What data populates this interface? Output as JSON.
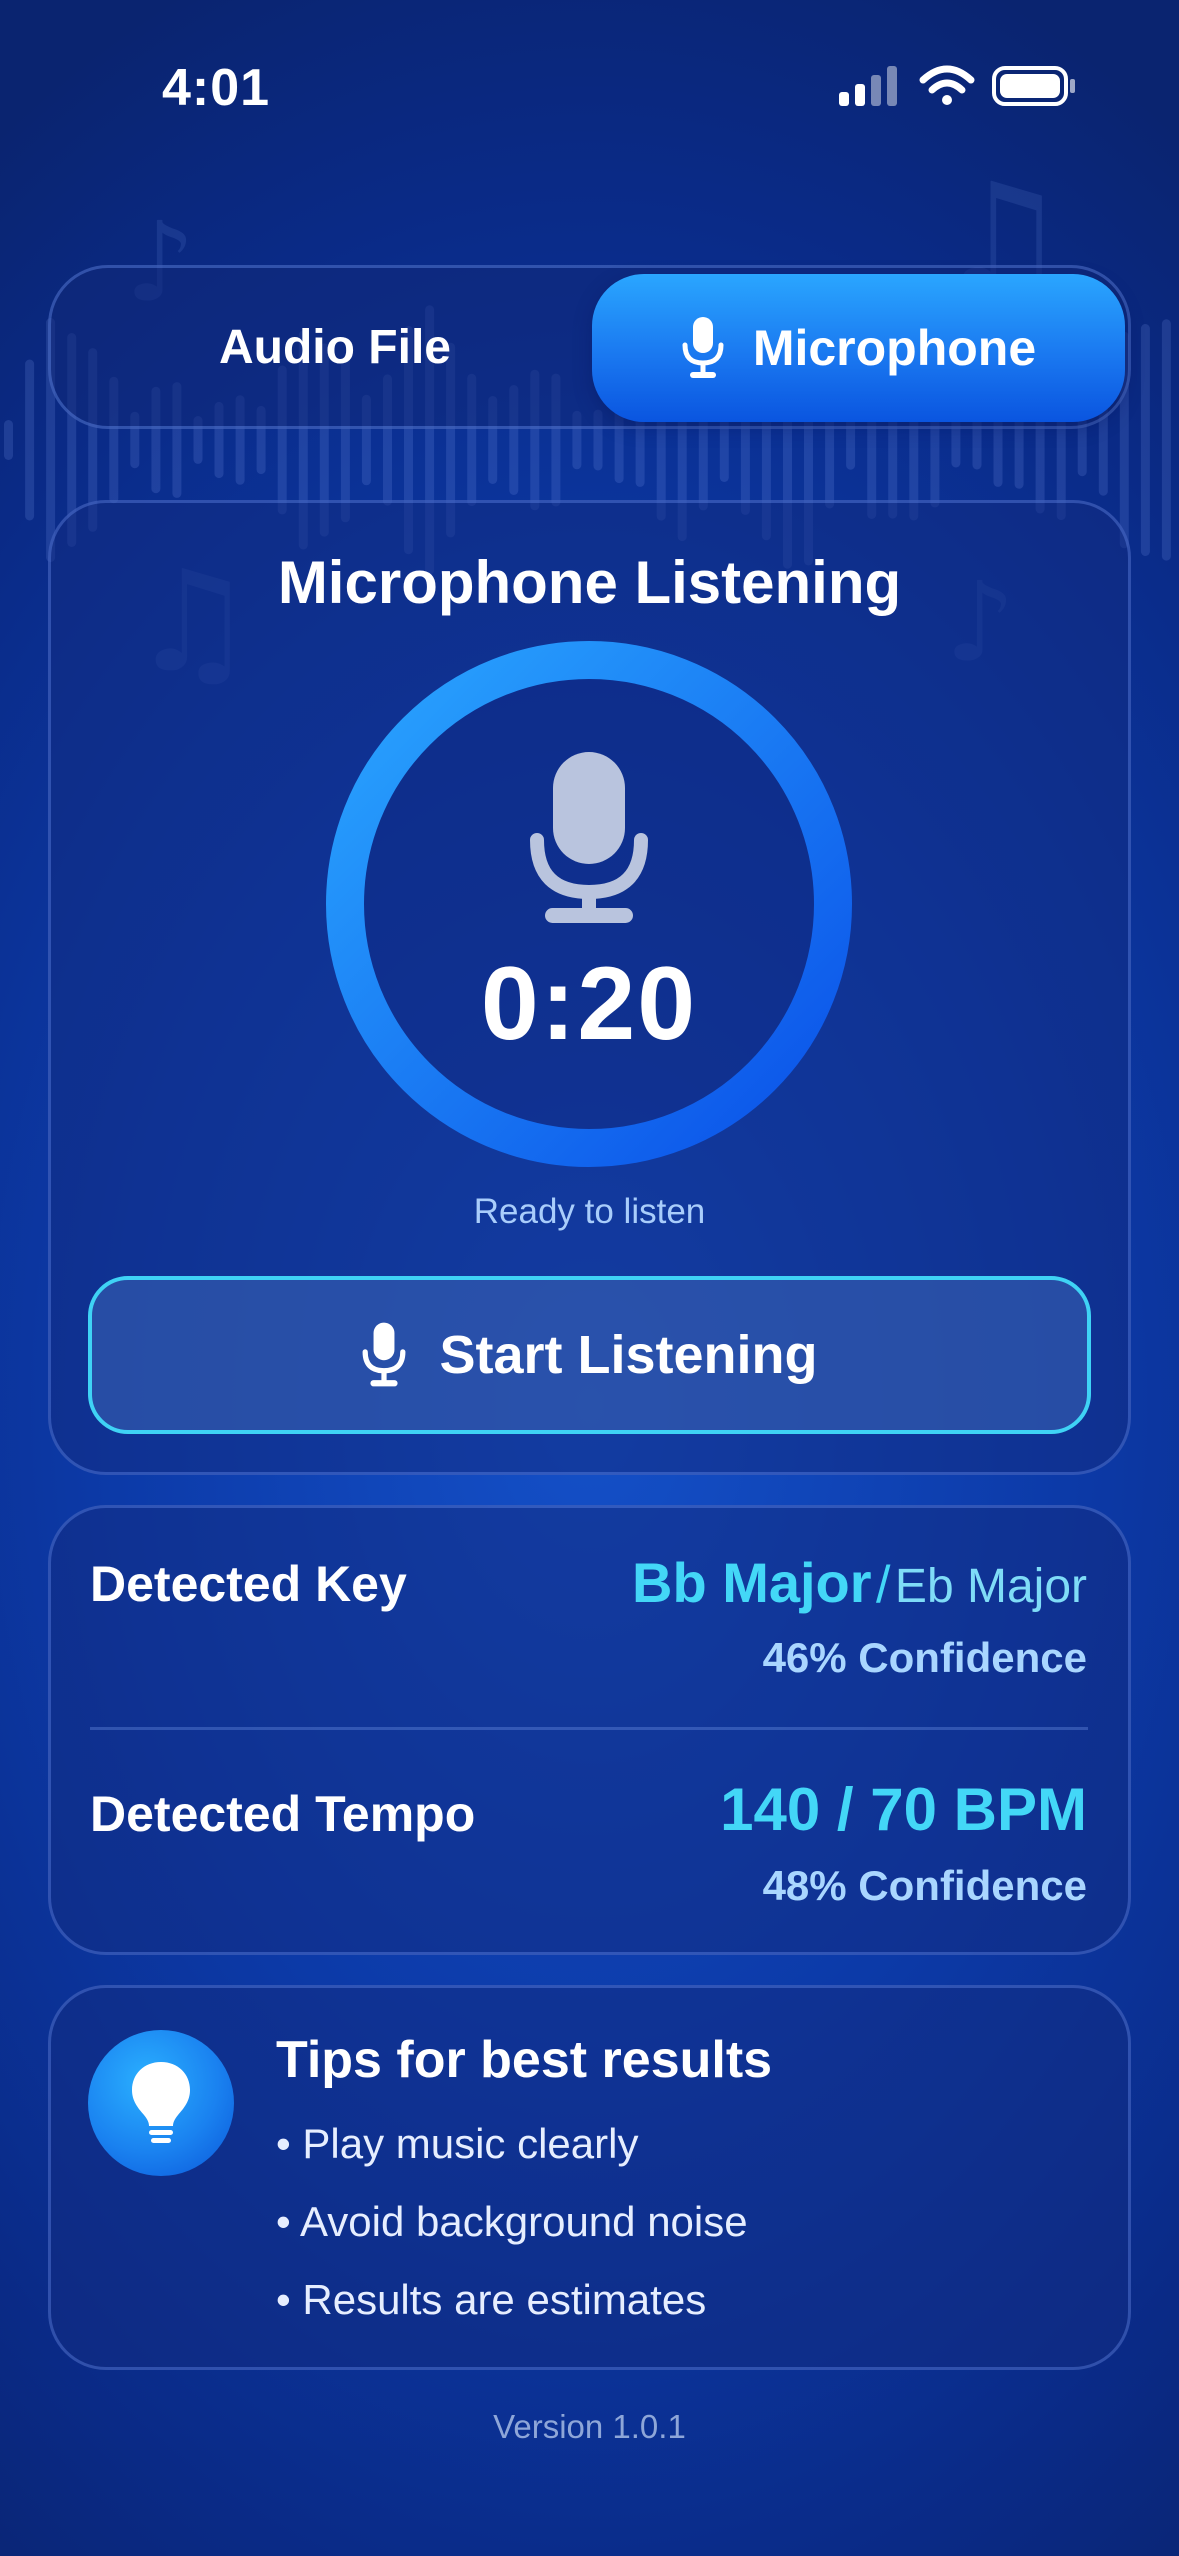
{
  "status_bar": {
    "time": "4:01",
    "icons": [
      "signal-icon",
      "wifi-icon",
      "battery-icon"
    ]
  },
  "mode_switch": {
    "options": [
      {
        "label": "Audio File",
        "selected": false
      },
      {
        "label": "Microphone",
        "selected": true,
        "icon": "microphone-icon"
      }
    ]
  },
  "listen_panel": {
    "title": "Microphone Listening",
    "timer": "0:20",
    "status": "Ready to listen",
    "start_button": {
      "label": "Start Listening",
      "icon": "microphone-icon"
    }
  },
  "results": {
    "key": {
      "label": "Detected Key",
      "primary": "Bb Major",
      "separator": "/",
      "alternate": "Eb Major",
      "confidence": "46% Confidence"
    },
    "tempo": {
      "label": "Detected Tempo",
      "value": "140 / 70 BPM",
      "confidence": "48% Confidence"
    }
  },
  "tips": {
    "icon": "lightbulb-icon",
    "title": "Tips for best results",
    "items": [
      "• Play music clearly",
      "• Avoid background noise",
      "• Results are estimates"
    ]
  },
  "footer": {
    "version": "Version 1.0.1"
  },
  "colors": {
    "background": "#0c3aa8",
    "accent": "#43d7f7",
    "button_border": "#3fd3f5",
    "selected_segment": "#1a78f0",
    "ring_start": "#2aa6ff",
    "ring_end": "#0a50e8"
  }
}
